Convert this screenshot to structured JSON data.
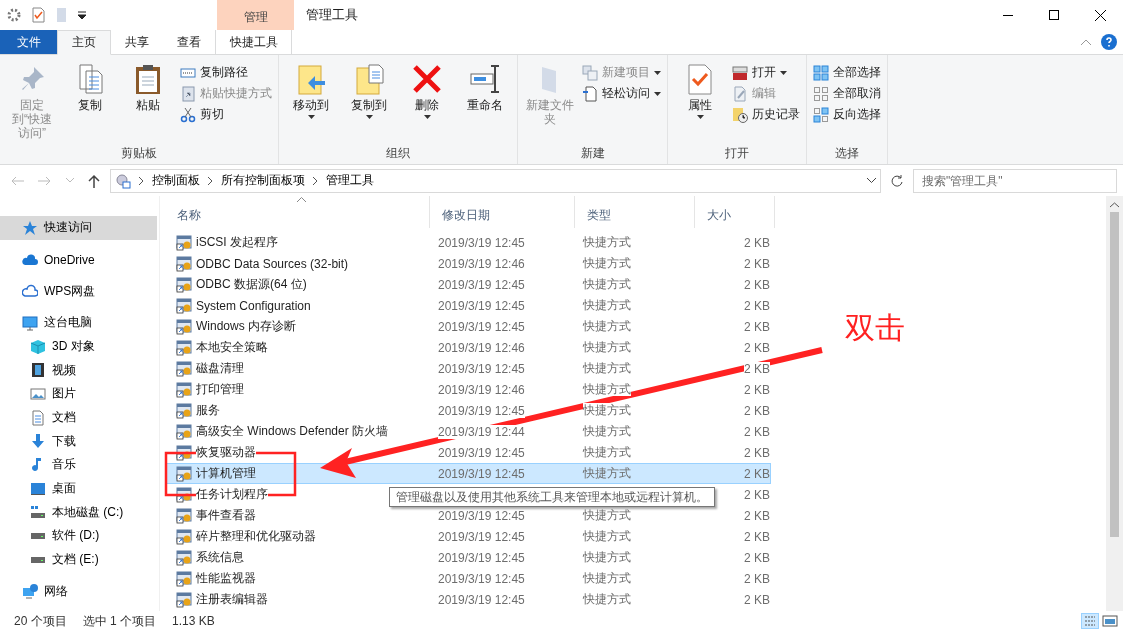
{
  "window": {
    "title": "管理工具",
    "context_tab": "管理"
  },
  "tabs": [
    {
      "label": "文件",
      "kind": "file",
      "selected": false
    },
    {
      "label": "主页",
      "kind": "tab",
      "selected": true
    },
    {
      "label": "共享",
      "kind": "tab",
      "selected": false
    },
    {
      "label": "查看",
      "kind": "tab",
      "selected": false
    },
    {
      "label": "快捷工具",
      "kind": "context",
      "selected": false
    }
  ],
  "ribbon": {
    "groups": [
      {
        "label": "剪贴板",
        "items": [
          {
            "label": "固定到“快速访问”",
            "kind": "large",
            "disabled": true,
            "has_menu": false
          },
          {
            "label": "复制",
            "kind": "large",
            "disabled": false,
            "has_menu": false
          },
          {
            "label": "粘贴",
            "kind": "large",
            "disabled": false,
            "has_menu": false
          },
          {
            "label": "复制路径",
            "kind": "small",
            "disabled": false,
            "has_menu": false
          },
          {
            "label": "粘贴快捷方式",
            "kind": "small",
            "disabled": true,
            "has_menu": false
          },
          {
            "label": "剪切",
            "kind": "small",
            "disabled": false,
            "has_menu": false
          }
        ]
      },
      {
        "label": "组织",
        "items": [
          {
            "label": "移动到",
            "kind": "large",
            "disabled": false,
            "has_menu": true
          },
          {
            "label": "复制到",
            "kind": "large",
            "disabled": false,
            "has_menu": true
          },
          {
            "label": "删除",
            "kind": "large",
            "disabled": false,
            "has_menu": true
          },
          {
            "label": "重命名",
            "kind": "large",
            "disabled": false,
            "has_menu": false
          }
        ]
      },
      {
        "label": "新建",
        "items": [
          {
            "label": "新建文件夹",
            "kind": "large",
            "disabled": true,
            "has_menu": false
          },
          {
            "label": "新建项目",
            "kind": "small",
            "disabled": true,
            "has_menu": true
          },
          {
            "label": "轻松访问",
            "kind": "small",
            "disabled": false,
            "has_menu": true
          }
        ]
      },
      {
        "label": "打开",
        "items": [
          {
            "label": "属性",
            "kind": "large",
            "disabled": false,
            "has_menu": true
          },
          {
            "label": "打开",
            "kind": "small",
            "disabled": false,
            "has_menu": true
          },
          {
            "label": "编辑",
            "kind": "small",
            "disabled": true,
            "has_menu": false
          },
          {
            "label": "历史记录",
            "kind": "small",
            "disabled": false,
            "has_menu": false
          }
        ]
      },
      {
        "label": "选择",
        "items": [
          {
            "label": "全部选择",
            "kind": "small",
            "disabled": false,
            "has_menu": false
          },
          {
            "label": "全部取消",
            "kind": "small",
            "disabled": false,
            "has_menu": false
          },
          {
            "label": "反向选择",
            "kind": "small",
            "disabled": false,
            "has_menu": false
          }
        ]
      }
    ]
  },
  "address": {
    "crumbs": [
      "控制面板",
      "所有控制面板项",
      "管理工具"
    ],
    "search_placeholder": "搜索\"管理工具\""
  },
  "sidebar": {
    "items": [
      {
        "label": "快速访问",
        "selected": true
      },
      {
        "label": "OneDrive",
        "selected": false
      },
      {
        "label": "WPS网盘",
        "selected": false
      },
      {
        "label": "这台电脑",
        "selected": false,
        "children": [
          {
            "label": "3D 对象",
            "selected": false
          },
          {
            "label": "视频",
            "selected": false
          },
          {
            "label": "图片",
            "selected": false
          },
          {
            "label": "文档",
            "selected": false
          },
          {
            "label": "下载",
            "selected": false
          },
          {
            "label": "音乐",
            "selected": false
          },
          {
            "label": "桌面",
            "selected": false
          },
          {
            "label": "本地磁盘 (C:)",
            "selected": false
          },
          {
            "label": "软件 (D:)",
            "selected": false
          },
          {
            "label": "文档 (E:)",
            "selected": false
          }
        ]
      },
      {
        "label": "网络",
        "selected": false
      }
    ]
  },
  "table": {
    "columns": [
      {
        "label": "名称",
        "sorted": true
      },
      {
        "label": "修改日期",
        "sorted": false
      },
      {
        "label": "类型",
        "sorted": false
      },
      {
        "label": "大小",
        "sorted": false
      }
    ],
    "rows": [
      {
        "name": "iSCSI 发起程序",
        "date": "2019/3/19 12:45",
        "type": "快捷方式",
        "size": "2 KB",
        "selected": false
      },
      {
        "name": "ODBC Data Sources (32-bit)",
        "date": "2019/3/19 12:46",
        "type": "快捷方式",
        "size": "2 KB",
        "selected": false
      },
      {
        "name": "ODBC 数据源(64 位)",
        "date": "2019/3/19 12:45",
        "type": "快捷方式",
        "size": "2 KB",
        "selected": false
      },
      {
        "name": "System Configuration",
        "date": "2019/3/19 12:45",
        "type": "快捷方式",
        "size": "2 KB",
        "selected": false
      },
      {
        "name": "Windows 内存诊断",
        "date": "2019/3/19 12:45",
        "type": "快捷方式",
        "size": "2 KB",
        "selected": false
      },
      {
        "name": "本地安全策略",
        "date": "2019/3/19 12:46",
        "type": "快捷方式",
        "size": "2 KB",
        "selected": false
      },
      {
        "name": "磁盘清理",
        "date": "2019/3/19 12:45",
        "type": "快捷方式",
        "size": "2 KB",
        "selected": false
      },
      {
        "name": "打印管理",
        "date": "2019/3/19 12:46",
        "type": "快捷方式",
        "size": "2 KB",
        "selected": false
      },
      {
        "name": "服务",
        "date": "2019/3/19 12:45",
        "type": "快捷方式",
        "size": "2 KB",
        "selected": false
      },
      {
        "name": "高级安全 Windows Defender 防火墙",
        "date": "2019/3/19 12:44",
        "type": "快捷方式",
        "size": "2 KB",
        "selected": false
      },
      {
        "name": "恢复驱动器",
        "date": "2019/3/19 12:45",
        "type": "快捷方式",
        "size": "2 KB",
        "selected": false
      },
      {
        "name": "计算机管理",
        "date": "2019/3/19 12:45",
        "type": "快捷方式",
        "size": "2 KB",
        "selected": true
      },
      {
        "name": "任务计划程序",
        "size": "2 KB",
        "selected": false
      },
      {
        "name": "事件查看器",
        "date": "2019/3/19 12:45",
        "type": "快捷方式",
        "size": "2 KB",
        "selected": false
      },
      {
        "name": "碎片整理和优化驱动器",
        "date": "2019/3/19 12:45",
        "type": "快捷方式",
        "size": "2 KB",
        "selected": false
      },
      {
        "name": "系统信息",
        "date": "2019/3/19 12:45",
        "type": "快捷方式",
        "size": "2 KB",
        "selected": false
      },
      {
        "name": "性能监视器",
        "date": "2019/3/19 12:45",
        "type": "快捷方式",
        "size": "2 KB",
        "selected": false
      },
      {
        "name": "注册表编辑器",
        "date": "2019/3/19 12:45",
        "type": "快捷方式",
        "size": "2 KB",
        "selected": false
      }
    ]
  },
  "tooltip": "管理磁盘以及使用其他系统工具来管理本地或远程计算机。",
  "annotation": {
    "label": "双击"
  },
  "status_bar": {
    "count": "20 个项目",
    "selection": "选中 1 个项目",
    "size": "1.13 KB"
  }
}
